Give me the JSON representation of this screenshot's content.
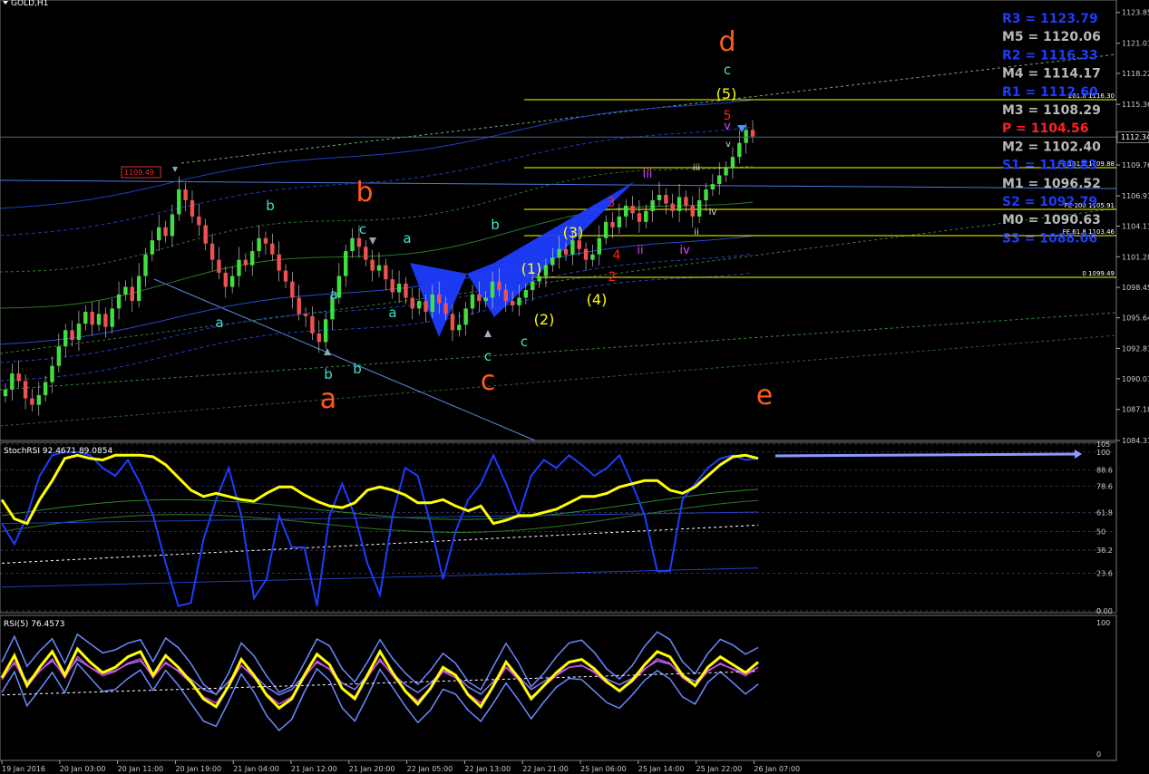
{
  "window": {
    "symbol_label": "GOLD,H1"
  },
  "colors": {
    "background": "#000000",
    "bull": "#40e040",
    "bear": "#f05050",
    "yellow": "#ffff00",
    "blue": "#1e3cff",
    "orange": "#ff5a1e",
    "cyan": "#40e0d0",
    "red": "#ff2020",
    "magenta": "#e040ff",
    "white": "#ffffff",
    "gray_text": "#c0c0c0"
  },
  "chart_data": [
    {
      "type": "candlestick",
      "title": "GOLD,H1",
      "ylim": [
        1084.31,
        1125.0
      ],
      "price_ticks": [
        "1123.85",
        "1121.01",
        "1118.22",
        "1115.36",
        "1112.34",
        "1109.76",
        "1106.91",
        "1104.11",
        "1101.28",
        "1098.45",
        "1095.64",
        "1092.81",
        "1090.01",
        "1087.18",
        "1084.31"
      ],
      "time_ticks": [
        "19 Jan 2016",
        "20 Jan 03:00",
        "20 Jan 11:00",
        "20 Jan 19:00",
        "21 Jan 04:00",
        "21 Jan 12:00",
        "21 Jan 20:00",
        "22 Jan 05:00",
        "22 Jan 13:00",
        "22 Jan 21:00",
        "25 Jan 06:00",
        "25 Jan 14:00",
        "25 Jan 22:00",
        "26 Jan 07:00"
      ],
      "current_price": "1112.34",
      "price_marker": "1109.49",
      "closes": [
        1089.0,
        1090.5,
        1089.8,
        1088.2,
        1087.6,
        1088.5,
        1089.7,
        1091.2,
        1093.0,
        1094.5,
        1093.6,
        1095.1,
        1096.2,
        1095.0,
        1096.0,
        1094.8,
        1096.5,
        1097.8,
        1098.5,
        1097.2,
        1099.5,
        1101.5,
        1102.8,
        1104.0,
        1103.2,
        1105.2,
        1107.5,
        1106.5,
        1105.0,
        1104.2,
        1102.5,
        1101.0,
        1099.8,
        1098.5,
        1099.5,
        1101.0,
        1100.5,
        1101.8,
        1103.0,
        1102.5,
        1101.5,
        1100.0,
        1099.0,
        1097.5,
        1096.0,
        1095.8,
        1094.2,
        1093.4,
        1095.5,
        1097.5,
        1099.5,
        1101.8,
        1103.0,
        1102.2,
        1101.0,
        1100.0,
        1100.5,
        1099.2,
        1098.0,
        1098.8,
        1097.5,
        1096.5,
        1097.2,
        1096.2,
        1097.8,
        1097.0,
        1096.0,
        1094.5,
        1095.0,
        1096.5,
        1097.8,
        1097.2,
        1097.5,
        1099.0,
        1098.2,
        1097.2,
        1096.8,
        1097.5,
        1098.2,
        1099.0,
        1099.5,
        1100.5,
        1101.2,
        1102.0,
        1101.5,
        1102.8,
        1102.0,
        1101.0,
        1101.5,
        1103.0,
        1104.5,
        1104.0,
        1105.0,
        1106.0,
        1105.3,
        1104.5,
        1105.5,
        1106.5,
        1107.0,
        1106.2,
        1105.5,
        1106.8,
        1106.0,
        1105.0,
        1106.5,
        1107.5,
        1108.0,
        1108.8,
        1109.5,
        1110.5,
        1111.8,
        1113.0,
        1112.4
      ]
    },
    {
      "type": "line",
      "title": "StochRSI 92.4671 89.0854",
      "ylim": [
        0,
        105
      ],
      "ticks": [
        "105",
        "100",
        "88.6",
        "78.6",
        "61.8",
        "50",
        "38.2",
        "23.6",
        "0.00",
        "0"
      ],
      "yellow": [
        70,
        58,
        55,
        70,
        82,
        96,
        98,
        96,
        95,
        98,
        98,
        98,
        97,
        92,
        84,
        76,
        72,
        74,
        72,
        70,
        69,
        74,
        78,
        78,
        73,
        69,
        66,
        65,
        68,
        76,
        78,
        76,
        73,
        68,
        68,
        70,
        66,
        63,
        66,
        55,
        57,
        60,
        60,
        62,
        64,
        68,
        72,
        72,
        74,
        78,
        80,
        82,
        82,
        76,
        74,
        78,
        85,
        92,
        97,
        98,
        96
      ],
      "blue": [
        55,
        42,
        60,
        85,
        98,
        100,
        100,
        98,
        90,
        85,
        95,
        80,
        60,
        30,
        3,
        5,
        45,
        70,
        90,
        60,
        8,
        20,
        60,
        40,
        40,
        3,
        60,
        80,
        60,
        30,
        10,
        60,
        90,
        85,
        55,
        20,
        50,
        70,
        80,
        98,
        80,
        60,
        85,
        95,
        90,
        98,
        92,
        85,
        90,
        98,
        80,
        60,
        25,
        25,
        70,
        80,
        90,
        96,
        98,
        95,
        96
      ]
    },
    {
      "type": "line",
      "title": "RSI(5) 76.4573",
      "ylim": [
        0,
        100
      ],
      "ticks": [
        "100",
        "0"
      ],
      "values": [
        58,
        75,
        52,
        66,
        78,
        60,
        80,
        70,
        62,
        66,
        74,
        78,
        60,
        75,
        66,
        55,
        42,
        36,
        52,
        72,
        60,
        45,
        35,
        42,
        60,
        76,
        68,
        50,
        42,
        60,
        78,
        62,
        48,
        38,
        50,
        66,
        60,
        45,
        36,
        52,
        70,
        58,
        42,
        52,
        62,
        70,
        72,
        65,
        55,
        48,
        56,
        68,
        78,
        74,
        60,
        52,
        66,
        74,
        68,
        62,
        70
      ]
    }
  ],
  "pivots": [
    {
      "label": "R3 = 1123.79",
      "color": "#1e3cff"
    },
    {
      "label": "M5 = 1120.06",
      "color": "#b8b8b8"
    },
    {
      "label": "R2 = 1116.33",
      "color": "#1e3cff"
    },
    {
      "label": "M4 = 1114.17",
      "color": "#b8b8b8"
    },
    {
      "label": "R1 = 1112.60",
      "color": "#1e3cff"
    },
    {
      "label": "M3 = 1108.29",
      "color": "#b8b8b8"
    },
    {
      "label": "P  = 1104.56",
      "color": "#ff2020"
    },
    {
      "label": "M2 = 1102.40",
      "color": "#b8b8b8"
    },
    {
      "label": "S1 = 1100.83",
      "color": "#1e3cff"
    },
    {
      "label": "M1 = 1096.52",
      "color": "#b8b8b8"
    },
    {
      "label": "S2 = 1092.79",
      "color": "#1e3cff"
    },
    {
      "label": "M0 = 1090.63",
      "color": "#b8b8b8"
    },
    {
      "label": "S3 = 1088.06",
      "color": "#1e3cff"
    }
  ],
  "fib_labels": [
    "261.8 1116.30",
    "FE 161.8 1109.88",
    "FE 100 1105.91",
    "FE 61.8 1103.46",
    "0 1099.49"
  ],
  "wave_labels": {
    "orange": [
      "d",
      "b",
      "a",
      "c",
      "e"
    ],
    "cyan": [
      "c",
      "b",
      "c",
      "b",
      "a",
      "a",
      "a",
      "a",
      "c",
      "b",
      "c",
      "b"
    ],
    "yellow": [
      "(5)",
      "(3)",
      "(1)",
      "(4)",
      "(2)",
      "v",
      "iii",
      "iv",
      "ii"
    ],
    "red": [
      "5",
      "3",
      "4",
      "2"
    ],
    "magenta": [
      "v",
      "iii",
      "ii",
      "iv"
    ]
  }
}
